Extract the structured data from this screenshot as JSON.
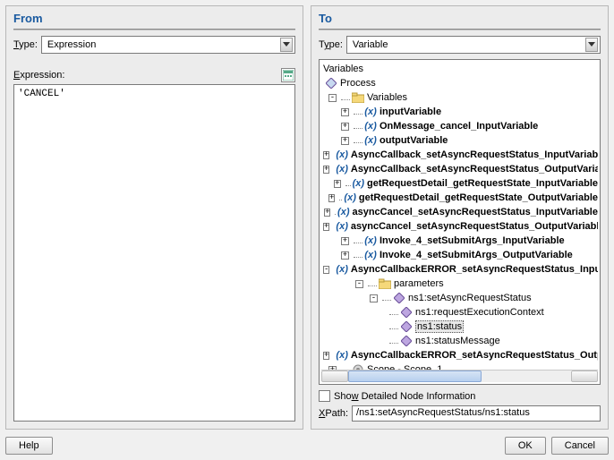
{
  "from": {
    "title": "From",
    "type_label": "Type:",
    "type_value": "Expression",
    "expression_label": "Expression:",
    "expression_value": "'CANCEL'"
  },
  "to": {
    "title": "To",
    "type_label": "Type:",
    "type_value": "Variable",
    "tree_root": "Variables",
    "process_label": "Process",
    "variables_label": "Variables",
    "vars": [
      "inputVariable",
      "OnMessage_cancel_InputVariable",
      "outputVariable",
      "AsyncCallback_setAsyncRequestStatus_InputVariable",
      "AsyncCallback_setAsyncRequestStatus_OutputVariable",
      "getRequestDetail_getRequestState_InputVariable",
      "getRequestDetail_getRequestState_OutputVariable",
      "asyncCancel_setAsyncRequestStatus_InputVariable",
      "asyncCancel_setAsyncRequestStatus_OutputVariable",
      "Invoke_4_setSubmitArgs_InputVariable",
      "Invoke_4_setSubmitArgs_OutputVariable"
    ],
    "expanded_var": "AsyncCallbackERROR_setAsyncRequestStatus_InputVariable",
    "parameters_label": "parameters",
    "op_label": "ns1:setAsyncRequestStatus",
    "children": [
      "ns1:requestExecutionContext",
      "ns1:status",
      "ns1:statusMessage"
    ],
    "selected_child_index": 1,
    "last_var": "AsyncCallbackERROR_setAsyncRequestStatus_OutputVariable",
    "scope_label": "Scope - Scope_1",
    "detailed_label": "Show Detailed Node Information",
    "xpath_label": "XPath:",
    "xpath_value": "/ns1:setAsyncRequestStatus/ns1:status"
  },
  "footer": {
    "help": "Help",
    "ok": "OK",
    "cancel": "Cancel"
  }
}
